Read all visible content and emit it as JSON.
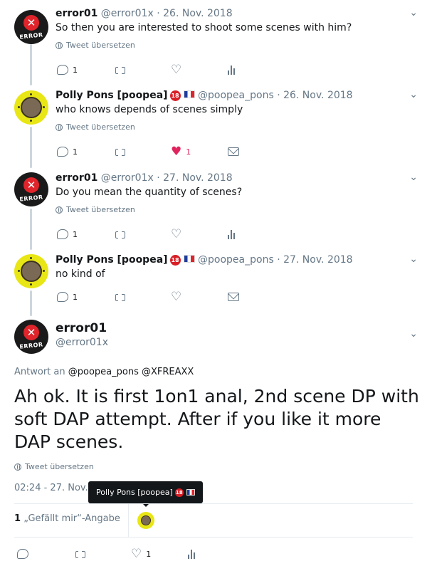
{
  "tweets": [
    {
      "name": "error01",
      "handle": "@error01x",
      "sep": "·",
      "date": "26. Nov. 2018",
      "text": "So then you are interested to shoot some scenes with him?",
      "translate": "Tweet übersetzen",
      "replies": "1",
      "likes": ""
    },
    {
      "name": "Polly Pons [poopea]",
      "handle": "@poopea_pons",
      "sep": "·",
      "date": "26. Nov. 2018",
      "text": "who knows depends of scenes simply",
      "translate": "Tweet übersetzen",
      "replies": "1",
      "likes": "1"
    },
    {
      "name": "error01",
      "handle": "@error01x",
      "sep": "·",
      "date": "27. Nov. 2018",
      "text": "Do you mean the quantity of scenes?",
      "translate": "Tweet übersetzen",
      "replies": "1",
      "likes": ""
    },
    {
      "name": "Polly Pons [poopea]",
      "handle": "@poopea_pons",
      "sep": "·",
      "date": "27. Nov. 2018",
      "text": "no kind of",
      "replies": "1",
      "likes": ""
    }
  ],
  "avatar_labels": {
    "error": "ERROR",
    "badge": "18"
  },
  "main": {
    "name": "error01",
    "handle": "@error01x",
    "reply_prefix": "Antwort an",
    "mention1": "@poopea_pons",
    "mention2": "@XFREAXX",
    "text": "Ah ok. It is first 1on1 anal, 2nd scene DP with soft DAP attempt. After if you like it more DAP scenes.",
    "translate": "Tweet übersetzen",
    "timestamp": "02:24 - 27. Nov.",
    "tooltip": "Polly Pons [poopea]",
    "likes_count": "1",
    "likes_label": "„Gefällt mir“-Angabe",
    "action_likes": "1"
  },
  "icons": {
    "reply": "reply-icon",
    "retweet": "retweet-icon",
    "like": "heart-icon",
    "analytics": "analytics-icon",
    "dm": "mail-icon",
    "menu": "chevron-down-icon",
    "translate": "globe-icon"
  },
  "colors": {
    "like": "#e0245e",
    "muted": "#657786",
    "text": "#14171a",
    "error_red": "#e0242b",
    "avatar_yellow": "#e8e614"
  }
}
